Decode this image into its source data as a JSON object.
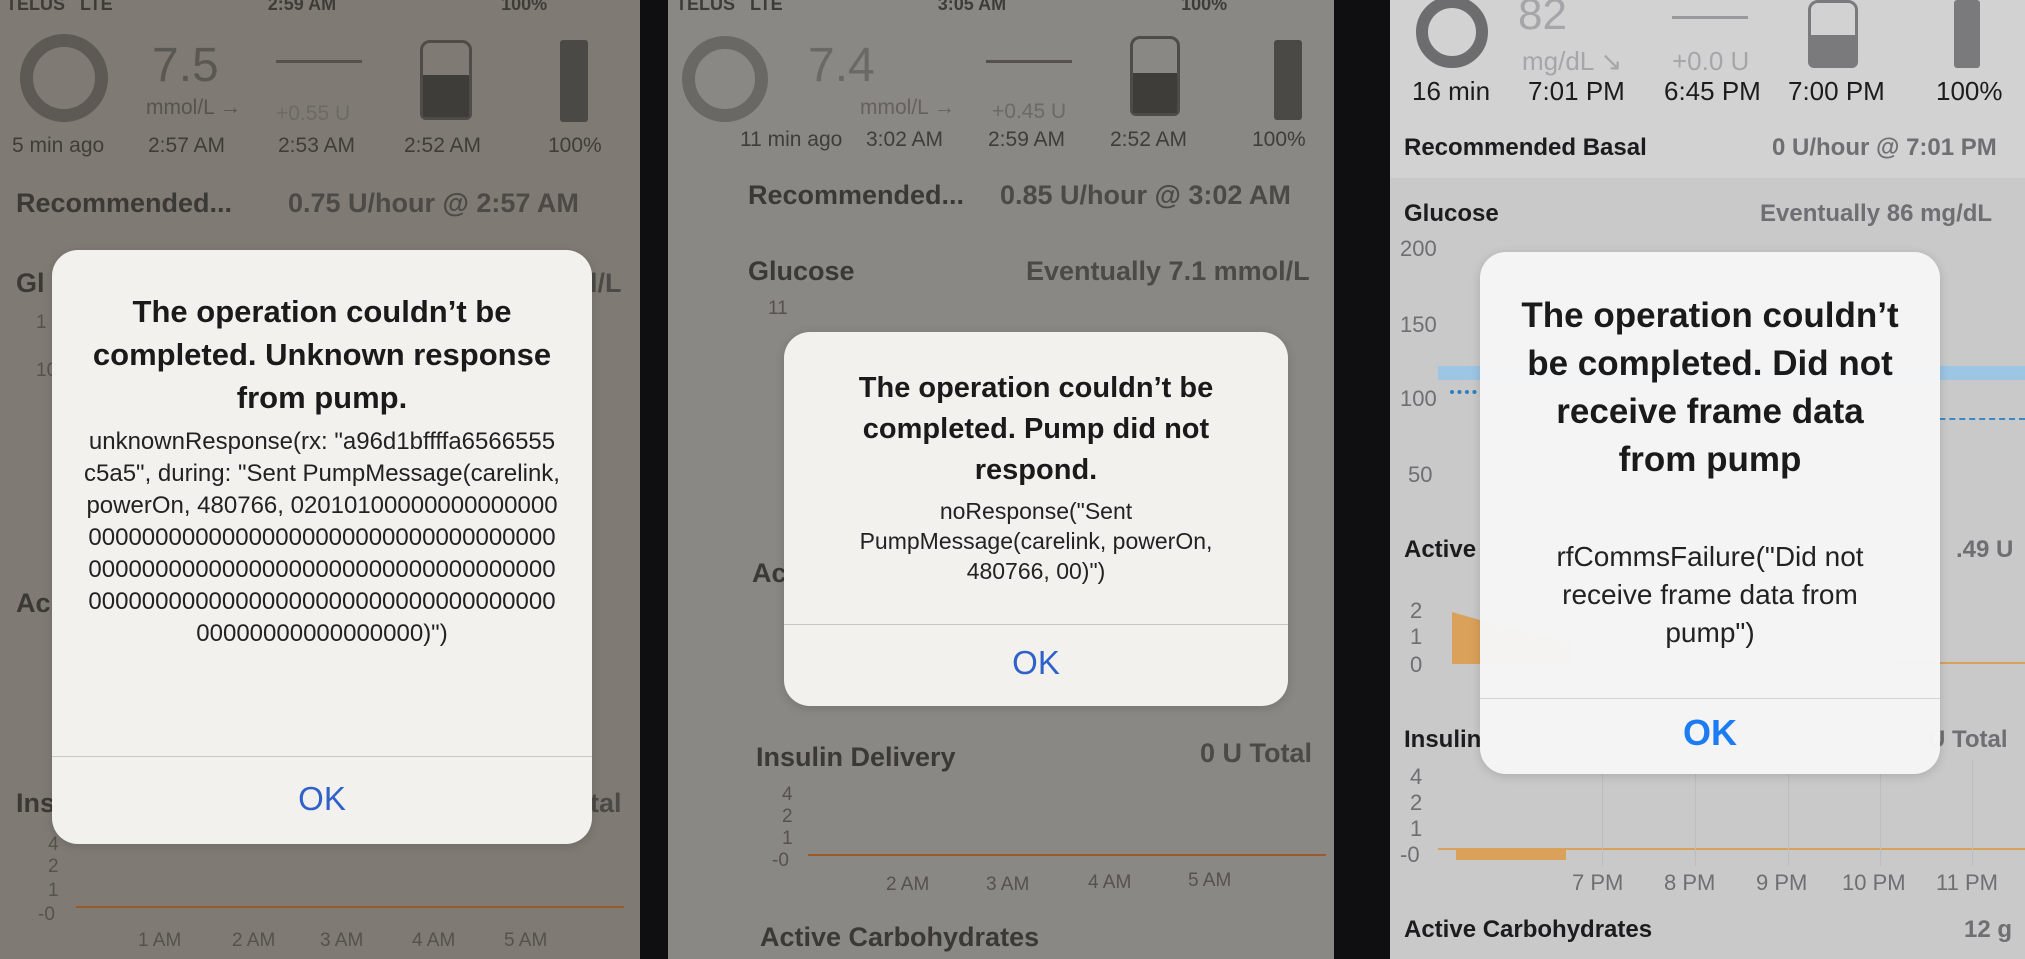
{
  "panel1": {
    "status": {
      "carrier": "TELUS",
      "network": "LTE",
      "time": "2:59 AM",
      "battery": "100%"
    },
    "hud": {
      "loop_ago": "5 min ago",
      "glucose_value": "7.5",
      "glucose_unit": "mmol/L →",
      "glucose_time": "2:57 AM",
      "temp_basal": "+0.55 U",
      "basal_time": "2:53 AM",
      "reservoir_time": "2:52 AM",
      "pump_battery": "100%"
    },
    "recommended_label": "Recommended...",
    "recommended_value": "0.75 U/hour @ 2:57 AM",
    "glucose_title_partial": "Gl",
    "glucose_unit_partial": "l/L",
    "axis_partial": [
      "1",
      "10"
    ],
    "active_partial": "Ac",
    "insulin_partial": "Ins",
    "total_partial": "tal",
    "insulin_axis": [
      "4",
      "2",
      "1",
      "-0"
    ],
    "time_axis": [
      "1 AM",
      "2 AM",
      "3 AM",
      "4 AM",
      "5 AM"
    ],
    "dialog": {
      "title": "The operation couldn’t be completed. Unknown response from pump.",
      "message": "unknownResponse(rx: \"a96d1bffffa6566555c5a5\", during: \"Sent PumpMessage(carelink, powerOn, 480766, 0201010000000000000000000000000000000000000000000000000000000000000000000000000000000000000000000000000000000000000000000000000000000000000000)\")",
      "ok": "OK"
    }
  },
  "panel2": {
    "status": {
      "carrier": "TELUS",
      "network": "LTE",
      "time": "3:05 AM",
      "battery": "100%"
    },
    "hud": {
      "loop_ago": "11 min ago",
      "glucose_value": "7.4",
      "glucose_unit": "mmol/L →",
      "glucose_time": "3:02 AM",
      "temp_basal": "+0.45 U",
      "basal_time": "2:59 AM",
      "reservoir_time": "2:52 AM",
      "pump_battery": "100%"
    },
    "recommended_label": "Recommended...",
    "recommended_value": "0.85 U/hour @ 3:02 AM",
    "glucose_title": "Glucose",
    "glucose_eventually": "Eventually 7.1 mmol/L",
    "glucose_axis_top": "11",
    "active_partial": "Ac",
    "insulin_title": "Insulin Delivery",
    "insulin_total": "0 U Total",
    "insulin_axis": [
      "4",
      "2",
      "1",
      "-0"
    ],
    "time_axis": [
      "2 AM",
      "3 AM",
      "4 AM",
      "5 AM"
    ],
    "carbs_title": "Active Carbohydrates",
    "dialog": {
      "title": "The operation couldn’t be completed. Pump did not respond.",
      "message": "noResponse(\"Sent PumpMessage(carelink, powerOn, 480766, 00)\")",
      "ok": "OK"
    }
  },
  "panel3": {
    "hud": {
      "loop_ago": "16 min",
      "glucose_value": "82",
      "glucose_unit": "mg/dL ↘",
      "glucose_time": "7:01 PM",
      "temp_basal": "+0.0 U",
      "basal_time": "6:45 PM",
      "reservoir_time": "7:00 PM",
      "pump_battery": "100%"
    },
    "recommended_label": "Recommended Basal",
    "recommended_value": "0 U/hour @ 7:01 PM",
    "glucose_title": "Glucose",
    "glucose_eventually": "Eventually 86 mg/dL",
    "glucose_axis": [
      "200",
      "150",
      "100",
      "50"
    ],
    "active_partial": "Active",
    "active_value_partial": ".49 U",
    "active_axis": [
      "2",
      "1",
      "0"
    ],
    "insulin_partial": "Insulin",
    "insulin_total_partial": "U Total",
    "insulin_axis": [
      "4",
      "2",
      "1",
      "-0"
    ],
    "time_axis": [
      "7 PM",
      "8 PM",
      "9 PM",
      "10 PM",
      "11 PM"
    ],
    "carbs_title": "Active Carbohydrates",
    "carbs_value": "12 g",
    "dialog": {
      "title": "The operation couldn’t be completed. Did not receive frame data from pump",
      "message": "rfCommsFailure(\"Did not receive frame data from pump\")",
      "ok": "OK"
    }
  },
  "colors": {
    "ok_blue": "#2e61c9",
    "ok_blue_clean": "#1b7cf3",
    "insulin_orange": "#d9a15a",
    "glucose_band": "#8cbfe6"
  }
}
